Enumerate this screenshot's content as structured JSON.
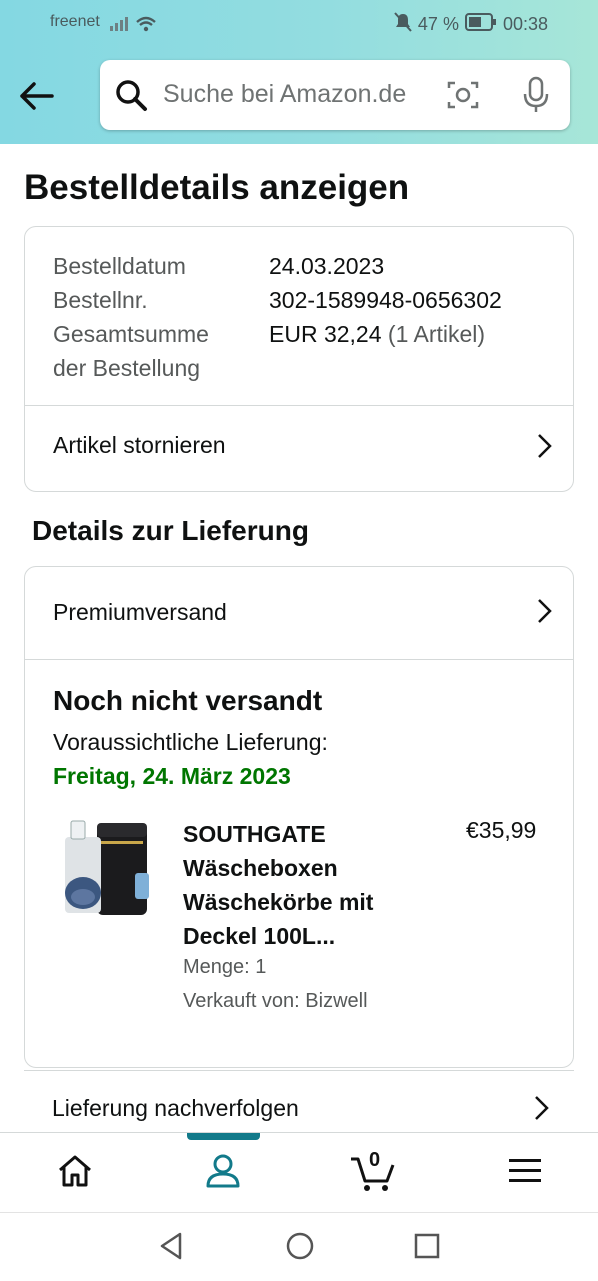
{
  "status": {
    "carrier": "freenet",
    "battery": "47 %",
    "time": "00:38"
  },
  "search": {
    "placeholder": "Suche bei Amazon.de"
  },
  "page": {
    "title": "Bestelldetails anzeigen"
  },
  "order": {
    "date_label": "Bestelldatum",
    "date_value": "24.03.2023",
    "number_label": "Bestellnr.",
    "number_value": "302-1589948-0656302",
    "total_label_1": "Gesamtsumme",
    "total_label_2": "der Bestellung",
    "total_value": "EUR 32,24",
    "total_items": "(1 Artikel)",
    "cancel_label": "Artikel stornieren"
  },
  "delivery": {
    "section_title": "Details zur Lieferung",
    "shipping_method": "Premiumversand",
    "status": "Noch nicht versandt",
    "eta_label": "Voraussichtliche Lieferung:",
    "eta_date": "Freitag, 24. März 2023",
    "product": {
      "name_lines": [
        "SOUTHGATE",
        "Wäscheboxen",
        "Wäschekörbe mit",
        "Deckel 100L..."
      ],
      "price": "€35,99",
      "quantity": "Menge: 1",
      "seller": "Verkauft von: Bizwell"
    },
    "track_label": "Lieferung nachverfolgen"
  },
  "nav": {
    "cart_count": "0",
    "active": "account"
  },
  "colors": {
    "accent": "#127a8a",
    "green": "#007600",
    "header": "#93dde0"
  }
}
